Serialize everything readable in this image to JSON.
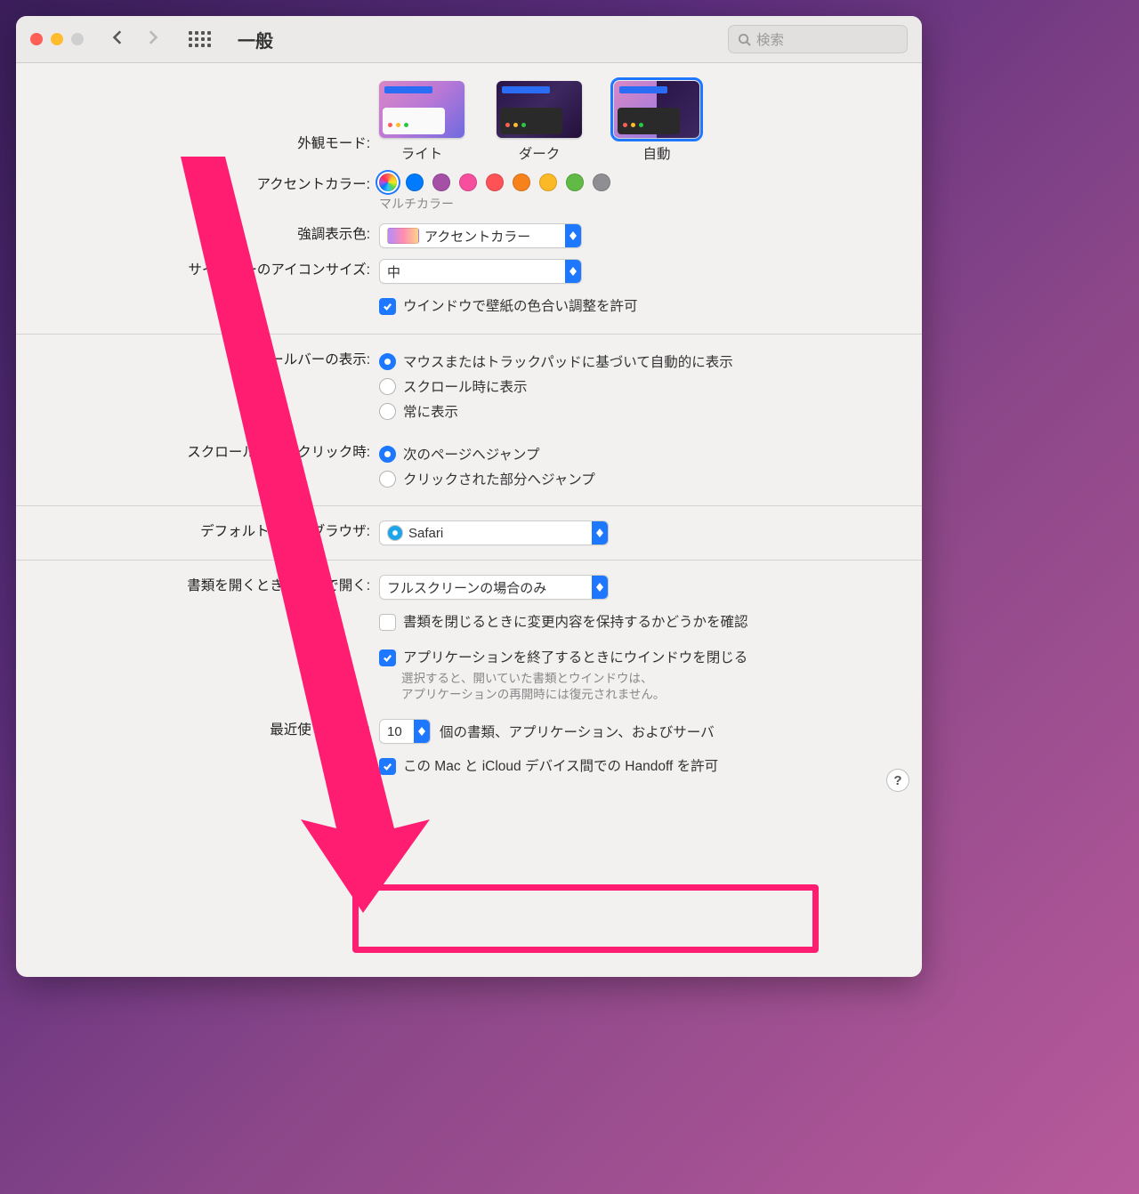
{
  "window": {
    "title": "一般",
    "search_placeholder": "検索"
  },
  "appearance": {
    "label": "外観モード:",
    "light": "ライト",
    "dark": "ダーク",
    "auto": "自動"
  },
  "accent": {
    "label": "アクセントカラー:",
    "multicolor_label": "マルチカラー",
    "colors": [
      "#007aff",
      "#a550a7",
      "#f74f9e",
      "#ff5257",
      "#f7821b",
      "#fbb927",
      "#62ba46",
      "#8e8e93"
    ]
  },
  "highlight": {
    "label": "強調表示色:",
    "value": "アクセントカラー"
  },
  "sidebar": {
    "label": "サイドバーのアイコンサイズ:",
    "value": "中"
  },
  "wallpaper_tint": {
    "label": "ウインドウで壁紙の色合い調整を許可"
  },
  "scrollbar_show": {
    "label": "スクロールバーの表示:",
    "opt1": "マウスまたはトラックパッドに基づいて自動的に表示",
    "opt2": "スクロール時に表示",
    "opt3": "常に表示"
  },
  "scrollbar_click": {
    "label": "スクロールバーのクリック時:",
    "opt1": "次のページへジャンプ",
    "opt2": "クリックされた部分へジャンプ"
  },
  "browser": {
    "label": "デフォルトのWebブラウザ:",
    "value": "Safari"
  },
  "tabs": {
    "label": "書類を開くときはタブで開く:",
    "value": "フルスクリーンの場合のみ"
  },
  "ask_changes": {
    "label": "書類を閉じるときに変更内容を保持するかどうかを確認"
  },
  "close_windows": {
    "label": "アプリケーションを終了するときにウインドウを閉じる",
    "desc1": "選択すると、開いていた書類とウインドウは、",
    "desc2": "アプリケーションの再開時には復元されません。"
  },
  "recent": {
    "label": "最近使った項目:",
    "value": "10",
    "suffix": "個の書類、アプリケーション、およびサーバ"
  },
  "handoff": {
    "label": "この Mac と iCloud デバイス間での Handoff を許可"
  },
  "help": "?"
}
